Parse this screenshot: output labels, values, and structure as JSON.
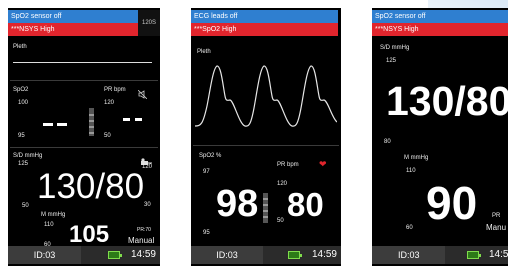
{
  "monitor1": {
    "alarm1": "SpO2 sensor off",
    "alarm2": "***NSYS High",
    "status_code": "120S",
    "pleth_label": "Pleth",
    "spo2_label": "SpO2",
    "spo2_hi": "100",
    "spo2_lo": "95",
    "pr_label": "PR bpm",
    "pr_hi": "120",
    "pr_lo": "50",
    "nibp_label": "S/D mmHg",
    "nibp_hi": "125",
    "nibp_right": "120",
    "nibp_value": "130/80",
    "nibp_lo": "50",
    "nibp_right_lo": "30",
    "mean_label": "M mmHg",
    "mean_hi": "110",
    "mean_lo": "60",
    "mean_value": "105",
    "pr_small": "PR:70",
    "mode": "Manual",
    "id": "ID:03",
    "time": "14:59",
    "alarm_off_icon": "alarm-off-icon",
    "cuff_icon": "cuff-icon"
  },
  "monitor2": {
    "alarm1": "ECG leads off",
    "alarm2": "***SpO2 High",
    "pleth_label": "Pleth",
    "spo2_label": "SpO2 %",
    "spo2_hi": "97",
    "spo2_lo": "95",
    "spo2_value": "98",
    "pr_label": "PR bpm",
    "pr_hi": "120",
    "pr_lo": "50",
    "pr_value": "80",
    "id": "ID:03",
    "time": "14:59",
    "heart_icon": "heart-icon"
  },
  "monitor3": {
    "alarm1": "SpO2 sensor off",
    "alarm2": "***NSYS High",
    "nibp_label": "S/D mmHg",
    "nibp_hi": "125",
    "nibp_value": "130/80",
    "nibp_lo": "80",
    "mean_label": "M mmHg",
    "mean_hi": "110",
    "mean_value": "90",
    "mean_lo": "60",
    "pr_small": "PR",
    "mode": "Manu",
    "id": "ID:03",
    "time": "14:59"
  },
  "colors": {
    "alarm_blue": "#2f7fd0",
    "alarm_red": "#e1252d",
    "battery": "#7fdc4c"
  }
}
